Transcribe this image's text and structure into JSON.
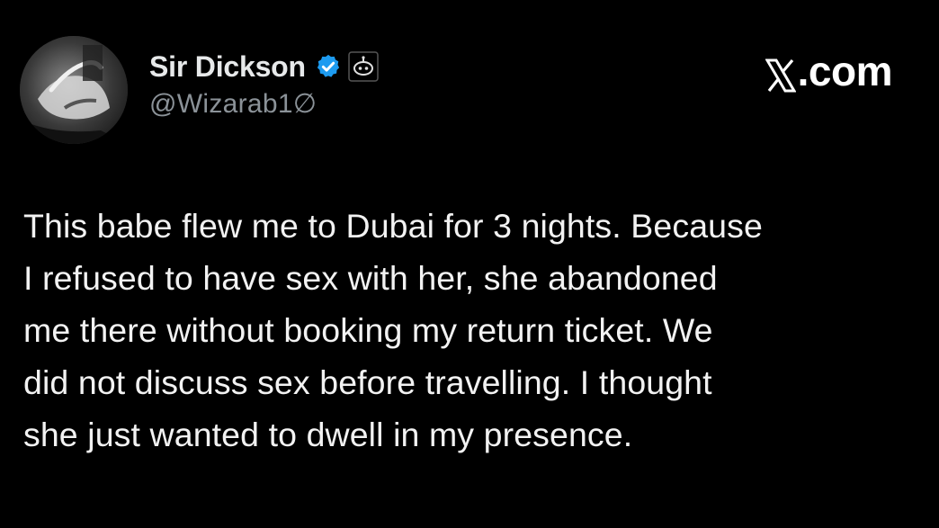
{
  "author": {
    "display_name": "Sir Dickson",
    "handle": "@Wizarab1∅",
    "verified": true,
    "badge_color": "#1d9bf0"
  },
  "site": {
    "label": ".com"
  },
  "tweet": {
    "lines": [
      "This babe flew me to Dubai for 3 nights. Because",
      "I refused to have sex with her, she abandoned",
      "me there without booking my return ticket. We",
      "did not discuss sex before travelling. I thought",
      "she just wanted to dwell in my presence."
    ]
  },
  "icons": {
    "avatar": "profile-photo",
    "verified": "verified-checkmark-icon",
    "bot_badge": "automated-account-icon",
    "site_logo": "x-logo-icon"
  },
  "colors": {
    "background": "#000000",
    "text_primary": "#e7e9ea",
    "text_secondary": "#8b9298",
    "accent": "#1d9bf0"
  }
}
